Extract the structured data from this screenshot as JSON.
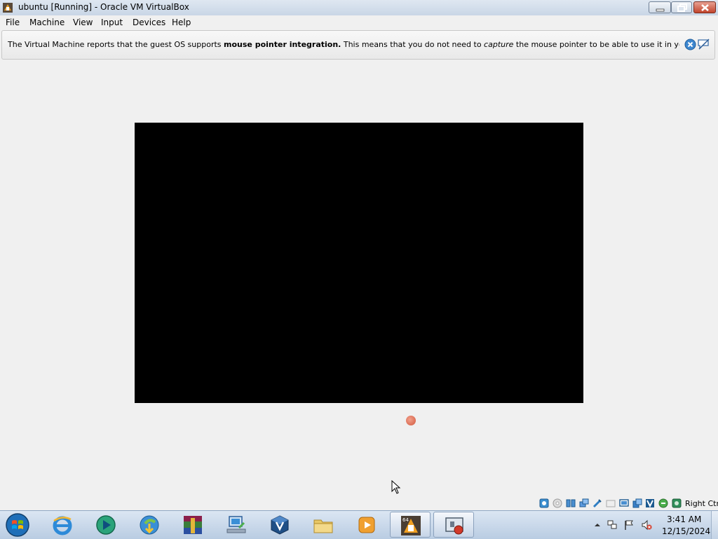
{
  "window": {
    "title": "ubuntu [Running] - Oracle VM VirtualBox",
    "icon": "virtualbox-icon"
  },
  "menu": {
    "items": [
      {
        "label": "File"
      },
      {
        "label": "Machine"
      },
      {
        "label": "View"
      },
      {
        "label": "Input"
      },
      {
        "label": "Devices"
      },
      {
        "label": "Help"
      }
    ]
  },
  "notice": {
    "text_1": "The Virtual Machine reports that the guest OS supports ",
    "bold": "mouse pointer integration.",
    "text_2": " This means that you do not need to ",
    "italic": "capture",
    "text_3": " the mouse pointer to be able to use it in your guest OS -- all mouse",
    "close_icon": "close-circle-icon",
    "hide_icon": "speech-bubble-hide-icon"
  },
  "statusbar": {
    "host_key": "Right Ctrl",
    "icons": [
      "hard-disk-icon",
      "optical-disk-icon",
      "audio-icon",
      "network-icon",
      "usb-icon",
      "shared-folders-icon",
      "display-icon",
      "video-capture-icon",
      "virtualization-icon",
      "mouse-integration-icon",
      "keyboard-icon"
    ]
  },
  "taskbar": {
    "apps": [
      "start-orb",
      "internet-explorer-icon",
      "media-player-icon",
      "download-manager-icon",
      "winrar-icon",
      "network-computer-icon",
      "virtualbox-icon",
      "file-explorer-icon",
      "media-center-icon",
      "virtualbox-vm-icon",
      "screen-recorder-icon"
    ],
    "clock_time": "3:41 AM",
    "clock_date": "12/15/2024"
  },
  "colors": {
    "accent": "#3a6ea5",
    "vm_screen": "#000000",
    "close_button": "#c2452c"
  }
}
